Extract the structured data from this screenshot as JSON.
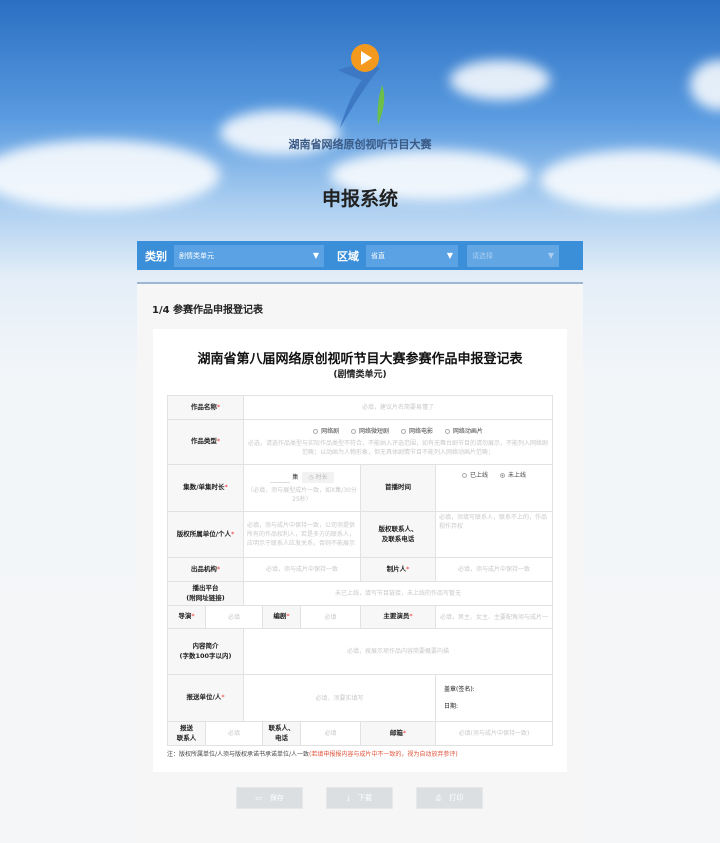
{
  "header": {
    "logo_text": "湖南省网络原创视听节目大赛",
    "system_title": "申报系统"
  },
  "filters": {
    "category_label": "类别",
    "category_value": "剧情类单元",
    "region_label": "区域",
    "province_value": "省直",
    "city_placeholder": "请选择"
  },
  "step": "1/4 参赛作品申报登记表",
  "form": {
    "title": "湖南省第八届网络原创视听节目大赛参赛作品申报登记表",
    "subtitle": "(剧情类单元)",
    "name": {
      "label": "作品名称",
      "placeholder": "必填，建议片名简要易懂了"
    },
    "type": {
      "label": "作品类型",
      "options": [
        "网络剧",
        "网络微短剧",
        "网络电影",
        "网络动画片"
      ],
      "hint": "必选，请选作品类型与实际作品类型不符合，不能纳入评选范围，如有无舞台剧节目的请勿展示，不能列入网络剧范畴；以动画为人物形象，但无具体剧情节目不能列入网络动画片范畴；"
    },
    "episodes": {
      "label": "集数/单集时长",
      "unit": "集",
      "duration_placeholder": "时长",
      "hint": "（必填，须与展型成片一致，如X集/30分25秒）"
    },
    "premiere": {
      "label": "首播时间",
      "options": [
        "已上线",
        "未上线"
      ],
      "selected": "未上线"
    },
    "rights_owner": {
      "label": "版权所属单位/个人",
      "placeholder": "必填，须与成片中保持一致，公司须提供所有的作品权利人，若是多方的联系人，应明示于联系人应发关系，否则不能展示"
    },
    "rights_contact": {
      "label1": "版权联系人、",
      "label2": "及联系电话",
      "placeholder": "必填，须填写联系人，联系不上的，作品视作弃权"
    },
    "producer_org": {
      "label": "出品机构",
      "placeholder": "必填，须与成片中保持一致"
    },
    "producer": {
      "label": "制片人",
      "placeholder": "必填，须与成片中保持一致"
    },
    "platform": {
      "label1": "播出平台",
      "label2": "(附网址链接)",
      "placeholder": "未已上线，填写节目链接，未上线的作品写暂无"
    },
    "director": {
      "label": "导演",
      "placeholder": "必填"
    },
    "writer": {
      "label": "编剧",
      "placeholder": "必填"
    },
    "actors": {
      "label": "主要演员",
      "placeholder": "必填，男主、女主、主要配角须与成片一"
    },
    "intro": {
      "label1": "内容简介",
      "label2": "(字数100字以内)",
      "placeholder": "必填，按展示项作品内容简要概要内描"
    },
    "submitter": {
      "label": "报送单位/人",
      "placeholder": "必填，须要实填写",
      "seal": "盖章(签名):",
      "date": "日期:"
    },
    "contact": {
      "label1": "报送",
      "label2": "联系人",
      "placeholder": "必填"
    },
    "phone": {
      "label1": "联系人、",
      "label2": "电话",
      "placeholder": "必填"
    },
    "email": {
      "label": "邮箱",
      "placeholder": "必填(须与成片中保持一致)"
    },
    "note": "注：版权所属单位/人须与版权承诺书承诺单位/人一致",
    "note_red": "(若填申报报内容与成片中不一致的，视为自动放弃参评)"
  },
  "buttons": {
    "save": "保存",
    "download": "下载",
    "print": "打印"
  },
  "colors": {
    "bar": "#3b8fd9",
    "required": "#e33"
  }
}
